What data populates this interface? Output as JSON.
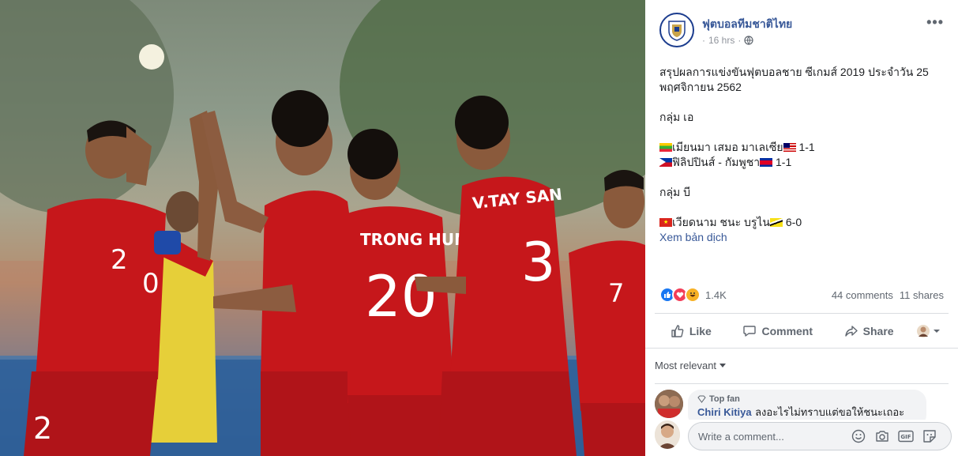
{
  "page": {
    "name": "ฟุตบอลทีมชาติไทย",
    "time": "16 hrs",
    "privacy_icon": "globe-icon",
    "more_label": "•••"
  },
  "post": {
    "line1": "สรุปผลการแข่งขันฟุตบอลชาย ซีเกมส์ 2019 ประจำวัน 25 พฤศจิกายน 2562",
    "group_a": "กลุ่ม เอ",
    "match1_a": "เมียนมา เสมอ มาเลเซีย",
    "match1_score": "1-1",
    "match2_a": "ฟิลิปปินส์ - กัมพูชา",
    "match2_score": "1-1",
    "group_b": "กลุ่ม บี",
    "match3_a": "เวียดนาม ชนะ บรูไน",
    "match3_score": "6-0",
    "see_translation": "Xem bản dịch"
  },
  "photo": {
    "jersey_numbers": [
      "2",
      "0",
      "20",
      "3",
      "7",
      "2"
    ],
    "jersey_names": [
      "TRONG HUNG",
      "V.TAY SAN"
    ]
  },
  "stats": {
    "reactions": [
      "like-icon",
      "love-icon",
      "haha-icon"
    ],
    "reaction_count": "1.4K",
    "comments": "44 comments",
    "shares": "11 shares"
  },
  "actions": {
    "like": "Like",
    "comment": "Comment",
    "share": "Share"
  },
  "comments": {
    "sort_label": "Most relevant",
    "top_fan_label": "Top fan",
    "first_author": "Chiri Kitiya",
    "first_text": "ลงอะไรไม่ทราบแต่ขอให้ชนะเถอะ"
  },
  "composer": {
    "placeholder": "Write a comment...",
    "gif_label": "GIF"
  },
  "colors": {
    "link": "#385898",
    "like_blue": "#1877f2",
    "love_red": "#f33e58",
    "haha_yellow": "#f7b125",
    "jersey_red": "#c6171b"
  }
}
